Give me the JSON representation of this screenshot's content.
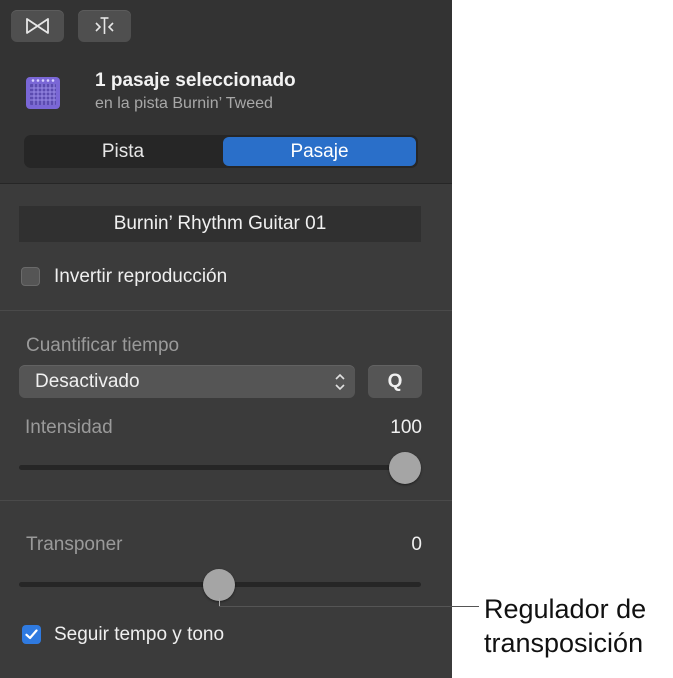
{
  "toolbar": {
    "buttons": [
      {
        "icon": "bowtie-icon"
      },
      {
        "icon": "split-marker-icon"
      }
    ]
  },
  "header": {
    "icon": "amplifier-icon",
    "title": "1 pasaje seleccionado",
    "subtitle": "en la pista Burnin’ Tweed"
  },
  "tabs": {
    "left": "Pista",
    "right": "Pasaje",
    "selected": "Pasaje"
  },
  "region": {
    "name": "Burnin’ Rhythm Guitar 01",
    "reverse_label": "Invertir reproducción",
    "reverse_checked": false
  },
  "quantize": {
    "label": "Cuantificar tiempo",
    "selected": "Desactivado",
    "q_button": "Q",
    "strength_label": "Intensidad",
    "strength_value": "100",
    "strength_fraction": 1.0
  },
  "transpose": {
    "label": "Transponer",
    "value": "0",
    "fraction": 0.5,
    "follow_label": "Seguir tempo y tono",
    "follow_checked": true
  },
  "callout": {
    "line1": "Regulador de",
    "line2": "transposición"
  },
  "colors": {
    "accent": "#2a6fc9",
    "checkbox_on": "#2f7ae0",
    "panel_bg": "#3b3b3b"
  }
}
